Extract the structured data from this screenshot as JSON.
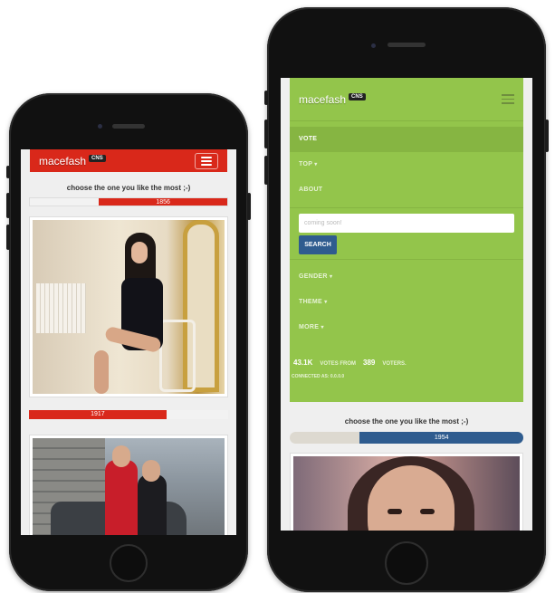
{
  "left_phone": {
    "brand": "macefash",
    "badge": "CNS",
    "heading": "choose the one you like the most ;-)",
    "bar_top": {
      "label": "1856",
      "fill_fraction": 0.65,
      "color": "#d9281a"
    },
    "bar_bottom": {
      "label": "1917",
      "fill_fraction": 0.69,
      "color": "#d9281a"
    }
  },
  "right_phone": {
    "brand": "macefash",
    "badge": "CNS",
    "menu": {
      "vote": "VOTE",
      "top": "TOP",
      "about": "ABOUT",
      "search_placeholder": "coming soon!",
      "search_button": "SEARCH",
      "gender": "GENDER",
      "theme": "THEME",
      "more": "MORE"
    },
    "stats": {
      "votes": "43.1K",
      "votes_label": "VOTES FROM",
      "voters": "389",
      "voters_label": "VOTERS.",
      "connected": "CONNECTED AS: 0.0.0.0"
    },
    "heading": "choose the one you like the most ;-)",
    "bar": {
      "label": "1954",
      "fill_fraction": 0.7,
      "color": "#2f5c8f"
    }
  },
  "icons": {
    "caret": "▾"
  },
  "colors": {
    "navbar_red": "#d9281a",
    "menu_green": "#93c54b",
    "button_blue": "#2f5c8f"
  }
}
